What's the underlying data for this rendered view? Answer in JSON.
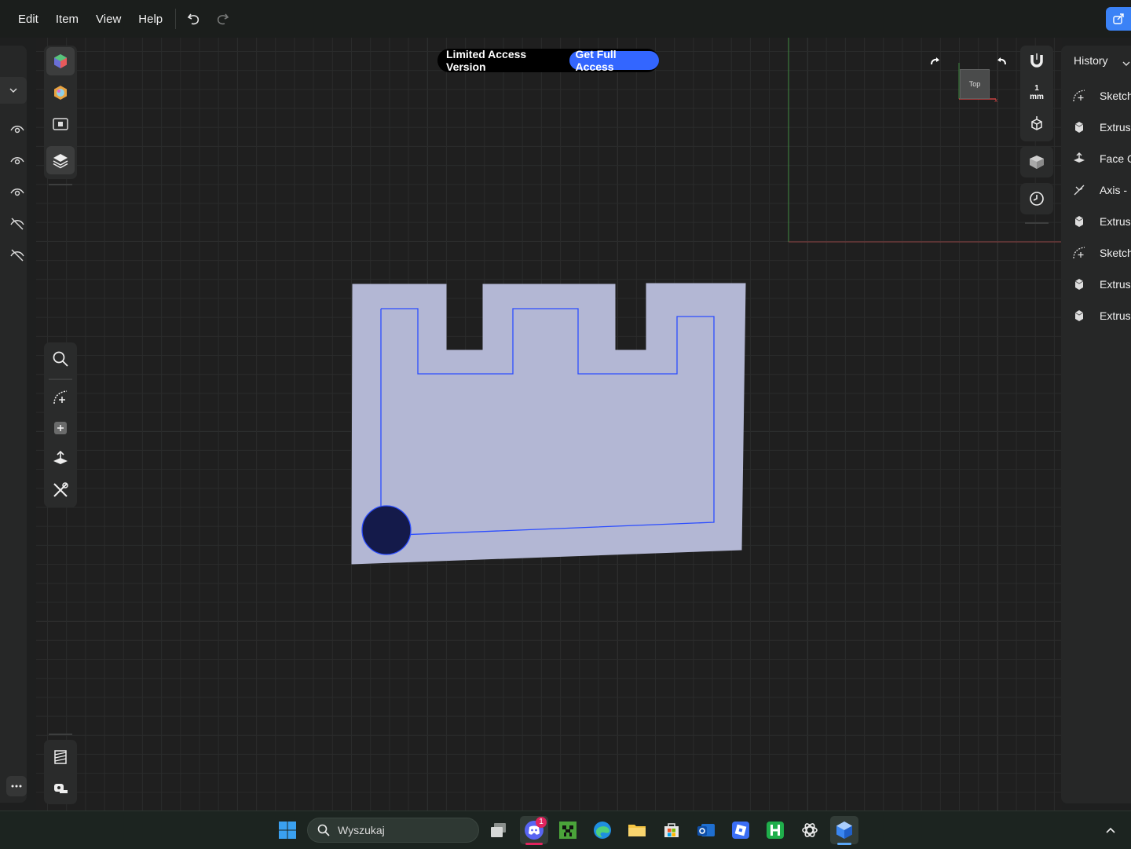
{
  "menu": {
    "items": [
      "Edit",
      "Item",
      "View",
      "Help"
    ]
  },
  "banner": {
    "text": "Limited Access Version",
    "button": "Get Full Access"
  },
  "units": {
    "value": "1",
    "unit": "mm"
  },
  "viewcube": {
    "face": "Top"
  },
  "history": {
    "title": "History",
    "items": [
      {
        "label": "Sketch",
        "icon": "sketch-icon"
      },
      {
        "label": "Extrusi",
        "icon": "extrusion-icon"
      },
      {
        "label": "Face O",
        "icon": "face-offset-icon"
      },
      {
        "label": "Axis - I",
        "icon": "axis-icon"
      },
      {
        "label": "Extrusi",
        "icon": "extrusion-icon"
      },
      {
        "label": "Sketch",
        "icon": "sketch-icon"
      },
      {
        "label": "Extrusi",
        "icon": "extrusion-icon"
      },
      {
        "label": "Extrusi",
        "icon": "extrusion-icon"
      }
    ]
  },
  "taskbar": {
    "search_placeholder": "Wyszukaj",
    "discord_badge": "1"
  },
  "colors": {
    "accent": "#3366ff",
    "part_face": "#b3b7d4",
    "sketch_line": "#2b4cff"
  }
}
